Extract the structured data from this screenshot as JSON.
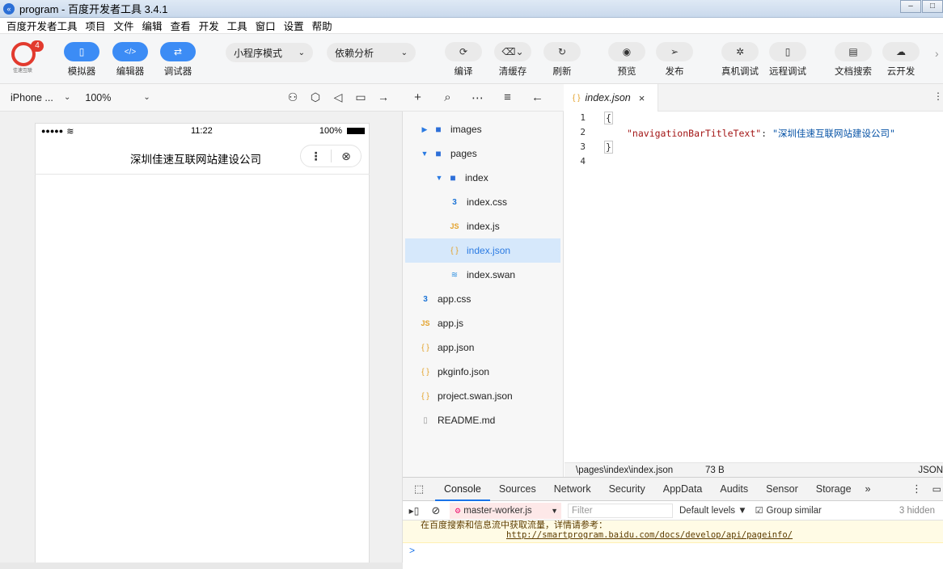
{
  "window": {
    "title": "program - 百度开发者工具 3.4.1"
  },
  "menu": [
    "百度开发者工具",
    "项目",
    "文件",
    "编辑",
    "查看",
    "开发",
    "工具",
    "窗口",
    "设置",
    "帮助"
  ],
  "toolbar": {
    "badge": "4",
    "logo_caption": "佳速互联",
    "simulator": "模拟器",
    "editor": "编辑器",
    "debugger": "调试器",
    "mode_select": "小程序模式",
    "dep_select": "依赖分析",
    "compile": "编译",
    "clear_cache": "清缓存",
    "refresh": "刷新",
    "preview": "预览",
    "publish": "发布",
    "device_debug": "真机调试",
    "remote_debug": "远程调试",
    "doc_search": "文档搜索",
    "cloud": "云开发"
  },
  "simulator": {
    "device": "iPhone ...",
    "zoom": "100%",
    "status_signal": "●●●●●",
    "status_time": "11:22",
    "status_battery": "100%",
    "nav_title": "深圳佳速互联网站建设公司"
  },
  "explorer": {
    "items": [
      {
        "label": "images",
        "type": "folder",
        "expanded": false
      },
      {
        "label": "pages",
        "type": "folder",
        "expanded": true
      },
      {
        "label": "index",
        "type": "folder",
        "expanded": true
      },
      {
        "label": "index.css",
        "type": "css"
      },
      {
        "label": "index.js",
        "type": "js"
      },
      {
        "label": "index.json",
        "type": "json",
        "selected": true
      },
      {
        "label": "index.swan",
        "type": "swan"
      },
      {
        "label": "app.css",
        "type": "css"
      },
      {
        "label": "app.js",
        "type": "js"
      },
      {
        "label": "app.json",
        "type": "json"
      },
      {
        "label": "pkginfo.json",
        "type": "json"
      },
      {
        "label": "project.swan.json",
        "type": "json"
      },
      {
        "label": "README.md",
        "type": "md"
      }
    ]
  },
  "editor": {
    "tab_name": "index.json",
    "lines": [
      "1",
      "2",
      "3",
      "4"
    ],
    "open_brace": "{",
    "close_brace": "}",
    "key": "\"navigationBarTitleText\"",
    "colon": ": ",
    "value": "\"深圳佳速互联网站建设公司\"",
    "status_path": "\\pages\\index\\index.json",
    "status_size": "73 B",
    "status_lang": "JSON"
  },
  "devtools": {
    "tabs": [
      "Console",
      "Sources",
      "Network",
      "Security",
      "AppData",
      "Audits",
      "Sensor",
      "Storage"
    ],
    "more": "»",
    "context": "master-worker.js",
    "filter_placeholder": "Filter",
    "levels": "Default levels ▼",
    "group_similar": "Group similar",
    "hidden_count": "3 hidden",
    "warn_text": "在百度搜索和信息流中获取流量，详情请参考：",
    "warn_link": "http://smartprogram.baidu.com/docs/develop/api/pageinfo/",
    "prompt": ">"
  }
}
